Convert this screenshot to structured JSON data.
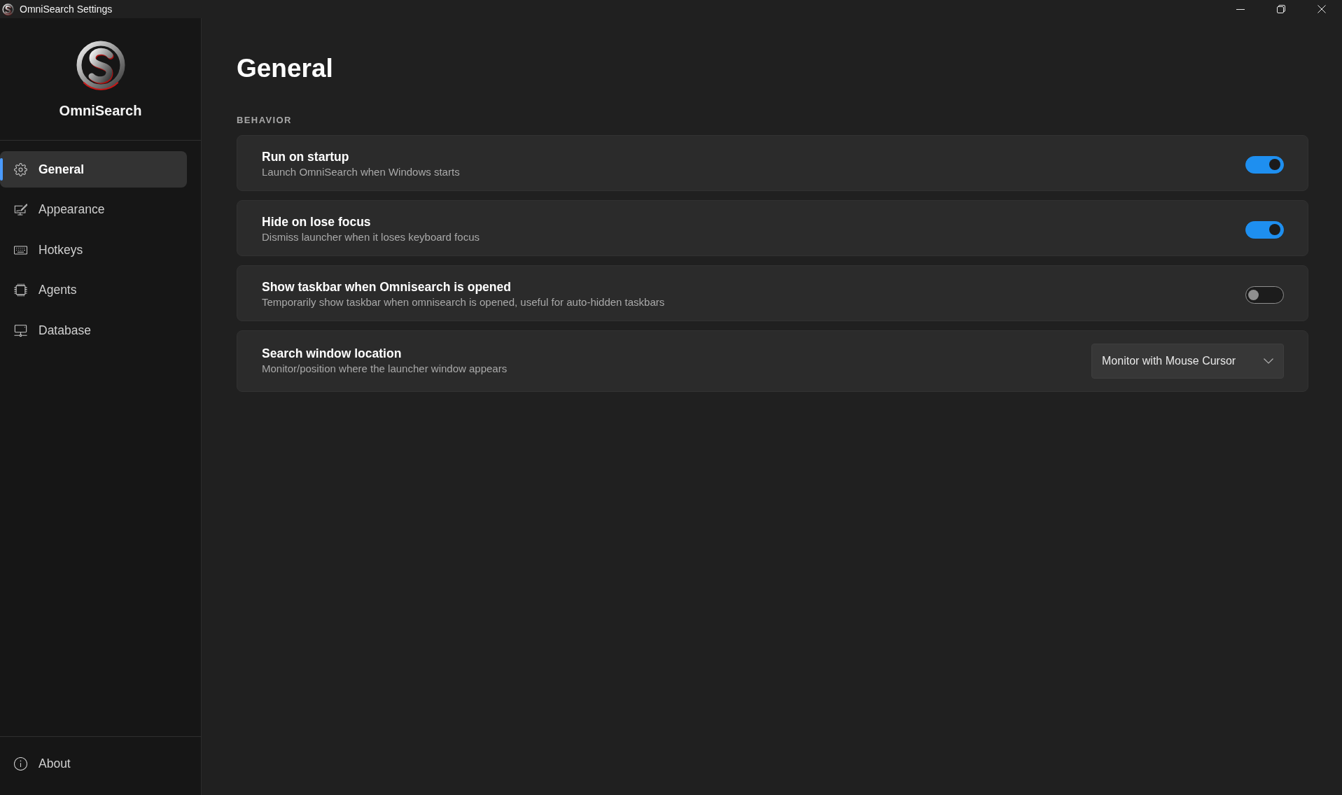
{
  "window": {
    "title": "OmniSearch Settings"
  },
  "sidebar": {
    "app_name": "OmniSearch",
    "items": [
      {
        "label": "General",
        "selected": true
      },
      {
        "label": "Appearance",
        "selected": false
      },
      {
        "label": "Hotkeys",
        "selected": false
      },
      {
        "label": "Agents",
        "selected": false
      },
      {
        "label": "Database",
        "selected": false
      }
    ],
    "footer_items": [
      {
        "label": "About",
        "selected": false
      }
    ]
  },
  "page": {
    "title": "General",
    "sections": [
      {
        "heading": "BEHAVIOR",
        "settings": [
          {
            "kind": "toggle",
            "title": "Run on startup",
            "description": "Launch OmniSearch when Windows starts",
            "on": true
          },
          {
            "kind": "toggle",
            "title": "Hide on lose focus",
            "description": "Dismiss launcher when it loses keyboard focus",
            "on": true
          },
          {
            "kind": "toggle",
            "title": "Show taskbar when Omnisearch is opened",
            "description": "Temporarily show taskbar when omnisearch is opened, useful for auto-hidden taskbars",
            "on": false
          },
          {
            "kind": "dropdown",
            "title": "Search window location",
            "description": "Monitor/position where the launcher window appears",
            "value": "Monitor with Mouse Cursor"
          }
        ]
      }
    ]
  }
}
